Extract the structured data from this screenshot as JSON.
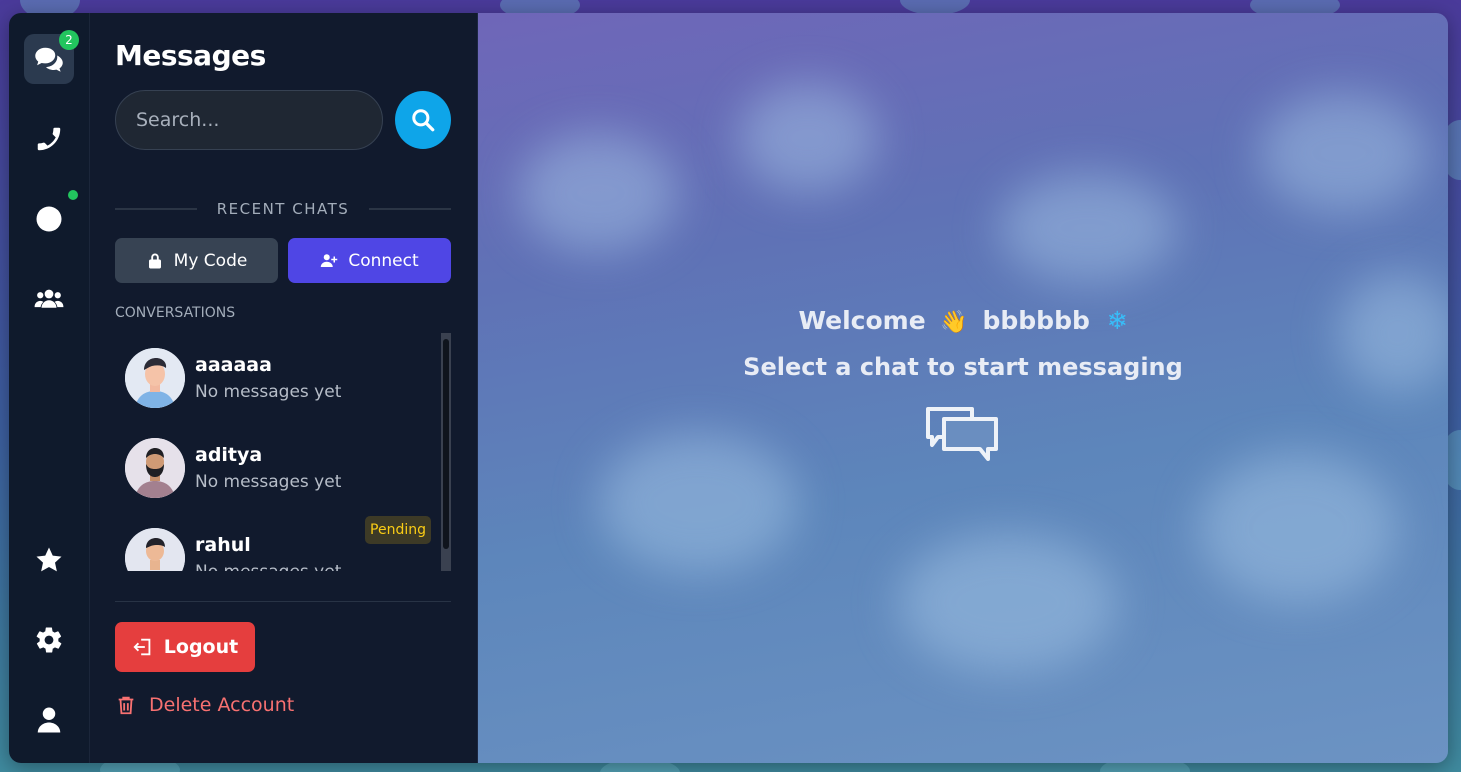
{
  "rail": {
    "chats_badge": "2"
  },
  "sidebar": {
    "title": "Messages",
    "search_placeholder": "Search...",
    "recent_label": "RECENT CHATS",
    "my_code_label": "My Code",
    "connect_label": "Connect",
    "conversations_label": "CONVERSATIONS",
    "conversations": [
      {
        "name": "aaaaaa",
        "preview": "No messages yet",
        "status": ""
      },
      {
        "name": "aditya",
        "preview": "No messages yet",
        "status": ""
      },
      {
        "name": "rahul",
        "preview": "No messages yet",
        "status": "Pending"
      }
    ],
    "logout_label": "Logout",
    "delete_label": "Delete Account"
  },
  "main": {
    "welcome_prefix": "Welcome",
    "wave_emoji": "👋",
    "username": "bbbbbb",
    "flake": "❄",
    "subtitle": "Select a chat to start messaging"
  },
  "colors": {
    "accent": "#4f46e5",
    "search_button": "#0ea5e9",
    "logout": "#e53e3e",
    "online": "#22c55e",
    "pending": "#facc15"
  }
}
